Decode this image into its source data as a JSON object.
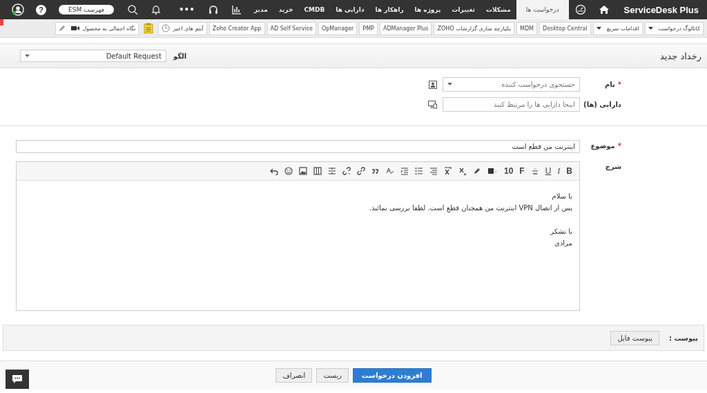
{
  "nav": {
    "logo": "ServiceDesk Plus",
    "tabs": [
      {
        "label": "درخواست ها",
        "selected": true
      },
      {
        "label": "مشکلات",
        "selected": false
      },
      {
        "label": "تغییرات",
        "selected": false
      },
      {
        "label": "پروژه ها",
        "selected": false
      },
      {
        "label": "راهکار ها",
        "selected": false
      },
      {
        "label": "دارایی ها",
        "selected": false
      },
      {
        "label": "CMDB",
        "selected": false
      },
      {
        "label": "خرید",
        "selected": false
      },
      {
        "label": "مدیر",
        "selected": false
      }
    ],
    "more": "•••",
    "esm_button": "فهرست ESM",
    "help": "?"
  },
  "toolbar": {
    "items": [
      {
        "kind": "dropdown",
        "label": "کاتالوگ درخواست"
      },
      {
        "kind": "dropdown",
        "label": "اقدامات سریع"
      },
      {
        "kind": "link",
        "label": "Desktop Central"
      },
      {
        "kind": "link",
        "label": "MDM"
      },
      {
        "kind": "link",
        "label": "یکپارچه سازی گزارشات ZOHO"
      },
      {
        "kind": "link",
        "label": "ADManager Plus"
      },
      {
        "kind": "link",
        "label": "PMP"
      },
      {
        "kind": "link",
        "label": "OpManager"
      },
      {
        "kind": "link",
        "label": "AD Self Service"
      },
      {
        "kind": "link",
        "label": "Zoho Creator App"
      },
      {
        "kind": "recent",
        "label": "آیتم های اخیر"
      },
      {
        "kind": "clipboard"
      },
      {
        "kind": "tour",
        "label": "نگاه اجمالی به محصول"
      }
    ]
  },
  "header": {
    "title": "رخداد جدید",
    "template_label": "الگو",
    "template_value": "Default Request"
  },
  "form": {
    "requester": {
      "label": "نام",
      "required_mark": "*",
      "placeholder": "جستجوی درخواست کننده"
    },
    "assets": {
      "label": "دارایی (ها)",
      "placeholder": "اینجا دارایی ها را مرتبط کنید"
    },
    "subject": {
      "label": "موضوع",
      "required_mark": "*",
      "value": "اینترنت من قطع است"
    },
    "description": {
      "label": "شرح",
      "tools": [
        {
          "kind": "bold",
          "label": "B"
        },
        {
          "kind": "italic",
          "label": "I"
        },
        {
          "kind": "underline",
          "label": "U"
        },
        {
          "kind": "strike"
        },
        {
          "kind": "font",
          "label": "F"
        },
        {
          "kind": "size",
          "label": "10"
        },
        {
          "kind": "color"
        },
        {
          "kind": "highlight"
        },
        {
          "kind": "subscript"
        },
        {
          "kind": "superscript"
        },
        {
          "kind": "align"
        },
        {
          "kind": "list"
        },
        {
          "kind": "indent"
        },
        {
          "kind": "format"
        },
        {
          "kind": "quote"
        },
        {
          "kind": "link"
        },
        {
          "kind": "unlink"
        },
        {
          "kind": "rule"
        },
        {
          "kind": "table"
        },
        {
          "kind": "image"
        },
        {
          "kind": "emoji"
        },
        {
          "kind": "undo"
        }
      ],
      "paragraphs": [
        [
          "با سلام",
          "پس از اتصال VPN اینترنت من همچنان قطع است. لطفا بررسی نمائید."
        ],
        [
          "با تشکر",
          "مرادی"
        ]
      ]
    }
  },
  "attachments": {
    "label": "پیوست :",
    "button": "پیوست فایل"
  },
  "actions": [
    {
      "kind": "primary",
      "label": "افزودن درخواست"
    },
    {
      "kind": "plain",
      "label": "ریست"
    },
    {
      "kind": "plain",
      "label": "انصراف"
    }
  ]
}
